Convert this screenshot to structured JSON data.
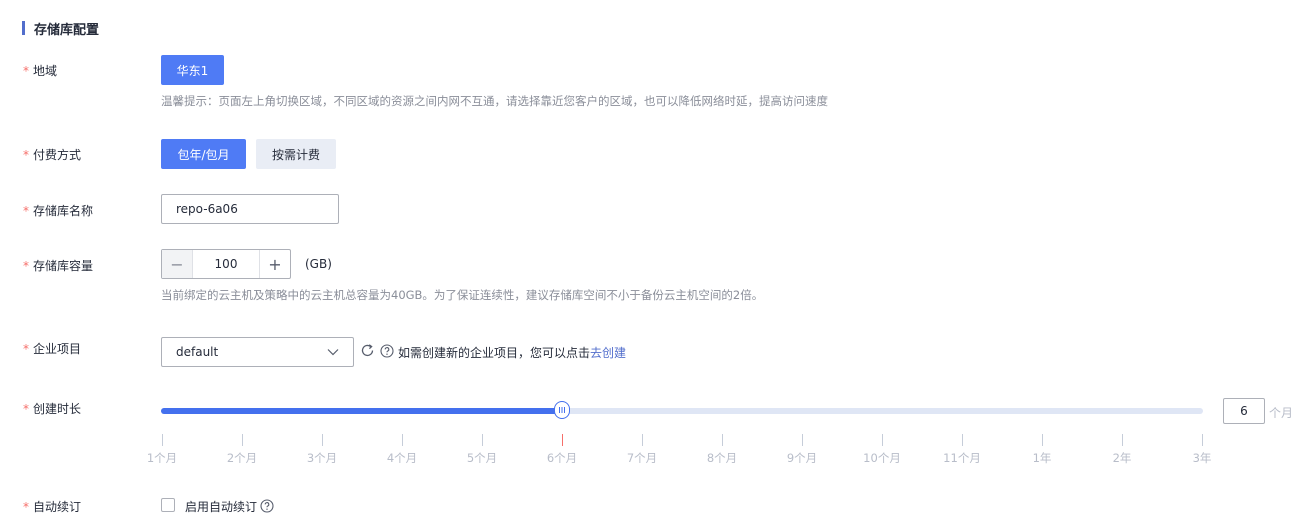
{
  "section": {
    "title": "存储库配置"
  },
  "region": {
    "label": "地域",
    "required_mark": "*",
    "selected": "华东1",
    "hint": "温馨提示：页面左上角切换区域，不同区域的资源之间内网不互通，请选择靠近您客户的区域，也可以降低网络时延，提高访问速度"
  },
  "billing": {
    "label": "付费方式",
    "required_mark": "*",
    "options": [
      "包年/包月",
      "按需计费"
    ],
    "selected": "包年/包月"
  },
  "repo_name": {
    "label": "存储库名称",
    "required_mark": "*",
    "value": "repo-6a06"
  },
  "capacity": {
    "label": "存储库容量",
    "required_mark": "*",
    "minus": "−",
    "value": "100",
    "plus": "+",
    "unit": "(GB)",
    "hint": "当前绑定的云主机及策略中的云主机总容量为40GB。为了保证连续性，建议存储库空间不小于备份云主机空间的2倍。"
  },
  "enterprise_project": {
    "label": "企业项目",
    "required_mark": "*",
    "value": "default",
    "tip": "如需创建新的企业项目，您可以点击",
    "link": "去创建"
  },
  "duration": {
    "label": "创建时长",
    "required_mark": "*",
    "ticks": [
      "1个月",
      "2个月",
      "3个月",
      "4个月",
      "5个月",
      "6个月",
      "7个月",
      "8个月",
      "9个月",
      "10个月",
      "11个月",
      "1年",
      "2年",
      "3年"
    ],
    "selected_index": 5,
    "input_value": "6",
    "unit": "个月"
  },
  "auto_renew": {
    "label": "自动续订",
    "required_mark": "*",
    "checkbox_label": "启用自动续订",
    "checked": false
  },
  "colors": {
    "primary": "#4f7bf5",
    "link": "#526ecc",
    "required": "#f66f6a",
    "hint": "#8a8e99"
  }
}
